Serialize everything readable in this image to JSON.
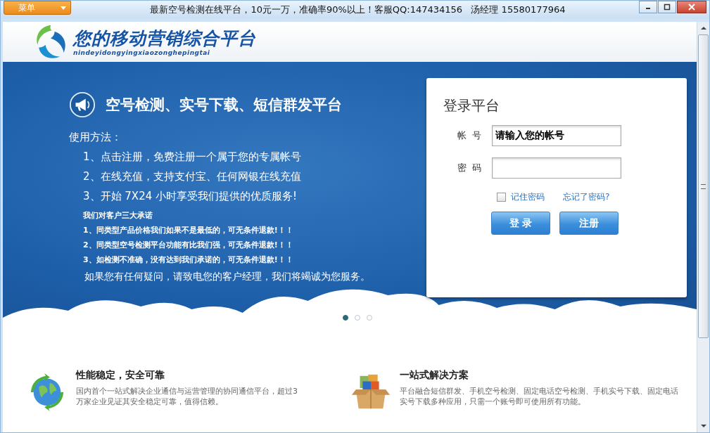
{
  "window": {
    "menu_button": "菜单",
    "title": "最新空号检测在线平台，10元一万，准确率90%以上！客服QQ:147434156   汤经理 15580177964"
  },
  "header": {
    "logo_title": "您的移动营销综合平台",
    "logo_subtitle": "nindeyidongyingxiaozonghepingtai"
  },
  "banner": {
    "headline": "空号检测、实号下载、短信群发平台",
    "usage_title": "使用方法：",
    "steps": [
      "1、点击注册，免费注册一个属于您的专属帐号",
      "2、在线充值，支持支付宝、任何网银在线充值",
      "3、开始 7X24 小时享受我们提供的优质服务!"
    ],
    "promise_title": "我们对客户三大承诺",
    "promises": [
      "1、同类型产品价格我们如果不是最低的，可无条件退款!！！",
      "2、同类型空号检测平台功能有比我们强，可无条件退款!！！",
      "3、如检测不准确，没有达到我们承诺的，可无条件退款!！！"
    ],
    "closing": "如果您有任何疑问，请致电您的客户经理，我们将竭诚为您服务。",
    "slides": [
      {
        "selected": true
      },
      {
        "selected": false
      },
      {
        "selected": false
      }
    ]
  },
  "login": {
    "title": "登录平台",
    "account_label": "帐  号",
    "account_value": "请输入您的帐号",
    "password_label": "密  码",
    "remember": {
      "label": "记住密码",
      "checked": false
    },
    "forgot_link": "忘记了密码?",
    "buttons": [
      "登 录",
      "注册"
    ]
  },
  "features": [
    {
      "title": "性能稳定，安全可靠",
      "text": "国内首个一站式解决企业通信与运营管理的协同通信平台，超过3万家企业见证其安全稳定可靠，值得信赖。"
    },
    {
      "title": "一站式解决方案",
      "text": "平台融合短信群发、手机空号检测、固定电话空号检测、手机实号下载、固定电话实号下载多种应用，只需一个账号即可使用所有功能。"
    }
  ]
}
